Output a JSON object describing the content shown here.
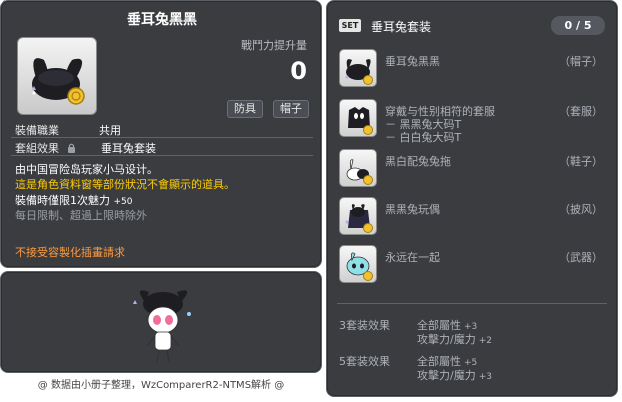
{
  "item_id": "01005668",
  "item": {
    "title": "垂耳兔黑黑",
    "power_label": "戰鬥力提升量",
    "power_value": "0",
    "tags": [
      "防具",
      "帽子"
    ],
    "job_label": "裝備職業",
    "job_value": "共用",
    "set_label": "套組效果",
    "set_value": "垂耳兔套装",
    "desc_line1": "由中国冒险岛玩家小马设计。",
    "desc_line2": "這是角色資料窗等部份狀況不會顯示的道具。",
    "desc_line3_prefix": "裝備時僅限1次魅力",
    "desc_line3_value": "+50",
    "desc_line4": "每日限制、超過上限時除外",
    "warning": "不接受容製化插畫請求"
  },
  "footer": "@ 数据由小册子整理，WzComparerR2-NTMS解析 @",
  "set_panel": {
    "badge": "SET",
    "name": "垂耳兔套装",
    "counter": "0 / 5",
    "items": [
      {
        "name": "垂耳兔黑黑",
        "slot": "（帽子）",
        "subs": []
      },
      {
        "name": "穿戴与性别相符的套服",
        "slot": "（套服）",
        "subs": [
          "－ 黑黑兔大码T",
          "－ 白白兔大码T"
        ]
      },
      {
        "name": "黑白配兔兔拖",
        "slot": "（鞋子）",
        "subs": []
      },
      {
        "name": "黑黑兔玩偶",
        "slot": "（披风）",
        "subs": []
      },
      {
        "name": "永远在一起",
        "slot": "（武器）",
        "subs": []
      }
    ],
    "effects": [
      {
        "label": "3套装效果",
        "stats": [
          {
            "name": "全部屬性",
            "value": "+3"
          },
          {
            "name": "攻擊力/魔力",
            "value": "+2"
          }
        ]
      },
      {
        "label": "5套装效果",
        "stats": [
          {
            "name": "全部屬性",
            "value": "+5"
          },
          {
            "name": "攻擊力/魔力",
            "value": "+3"
          }
        ]
      }
    ]
  },
  "colors": {
    "panel_bg": "#3a3c40",
    "highlight_yellow": "#ffcc00",
    "warning_orange": "#ff9a3c",
    "muted_gray": "#9aa0a6"
  },
  "icons": {
    "item": "bunny-hat-icon",
    "lock": "lock-icon",
    "set_items": [
      "bunny-hat-icon",
      "outfit-icon",
      "bunny-slippers-icon",
      "bunny-doll-cape-icon",
      "bunny-weapon-icon"
    ]
  }
}
